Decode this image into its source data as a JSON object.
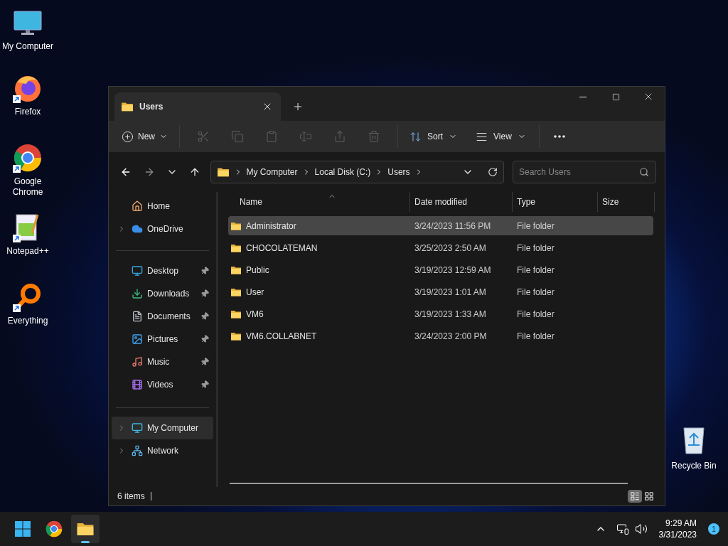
{
  "desktop_icons": [
    {
      "label": "My Computer",
      "kind": "monitor",
      "shortcut": false
    },
    {
      "label": "Firefox",
      "kind": "firefox",
      "shortcut": true
    },
    {
      "label": "Google Chrome",
      "kind": "chrome",
      "shortcut": true
    },
    {
      "label": "Notepad++",
      "kind": "notepad",
      "shortcut": true
    },
    {
      "label": "Everything",
      "kind": "everything",
      "shortcut": true
    }
  ],
  "recycle_bin": {
    "label": "Recycle Bin"
  },
  "window": {
    "tab": {
      "title": "Users"
    },
    "toolbar": {
      "new": "New",
      "actions": [
        {
          "kind": "cut",
          "disabled": true
        },
        {
          "kind": "copy",
          "disabled": true
        },
        {
          "kind": "paste",
          "disabled": true
        },
        {
          "kind": "rename",
          "disabled": true
        },
        {
          "kind": "share",
          "disabled": true
        },
        {
          "kind": "delete",
          "disabled": true
        }
      ],
      "sort": "Sort",
      "view": "View"
    },
    "nav": {
      "back_disabled": false,
      "forward_disabled": true
    },
    "breadcrumb": [
      "My Computer",
      "Local Disk (C:)",
      "Users"
    ],
    "search": {
      "placeholder": "Search Users"
    },
    "sidebar": [
      {
        "group": [
          {
            "label": "Home",
            "kind": "home",
            "expandable": false,
            "pinned": false,
            "selected": false
          },
          {
            "label": "OneDrive",
            "kind": "cloud",
            "expandable": true,
            "pinned": false,
            "selected": false
          }
        ]
      },
      {
        "group": [
          {
            "label": "Desktop",
            "kind": "desktop",
            "expandable": false,
            "pinned": true,
            "selected": false
          },
          {
            "label": "Downloads",
            "kind": "download",
            "expandable": false,
            "pinned": true,
            "selected": false
          },
          {
            "label": "Documents",
            "kind": "document",
            "expandable": false,
            "pinned": true,
            "selected": false
          },
          {
            "label": "Pictures",
            "kind": "picture",
            "expandable": false,
            "pinned": true,
            "selected": false
          },
          {
            "label": "Music",
            "kind": "music",
            "expandable": false,
            "pinned": true,
            "selected": false
          },
          {
            "label": "Videos",
            "kind": "video",
            "expandable": false,
            "pinned": true,
            "selected": false
          }
        ]
      },
      {
        "group": [
          {
            "label": "My Computer",
            "kind": "monitor",
            "expandable": true,
            "pinned": false,
            "selected": true
          },
          {
            "label": "Network",
            "kind": "network",
            "expandable": true,
            "pinned": false,
            "selected": false
          }
        ]
      }
    ],
    "columns": [
      "Name",
      "Date modified",
      "Type",
      "Size"
    ],
    "rows": [
      {
        "name": "Administrator",
        "date": "3/24/2023 11:56 PM",
        "type": "File folder",
        "selected": true
      },
      {
        "name": "CHOCOLATEMAN",
        "date": "3/25/2023 2:50 AM",
        "type": "File folder",
        "selected": false
      },
      {
        "name": "Public",
        "date": "3/19/2023 12:59 AM",
        "type": "File folder",
        "selected": false
      },
      {
        "name": "User",
        "date": "3/19/2023 1:01 AM",
        "type": "File folder",
        "selected": false
      },
      {
        "name": "VM6",
        "date": "3/19/2023 1:33 AM",
        "type": "File folder",
        "selected": false
      },
      {
        "name": "VM6.COLLABNET",
        "date": "3/24/2023 2:00 PM",
        "type": "File folder",
        "selected": false
      }
    ],
    "status": "6 items",
    "views": [
      {
        "kind": "details",
        "selected": true
      },
      {
        "kind": "tiles",
        "selected": false
      }
    ]
  },
  "taskbar": {
    "apps": [
      {
        "kind": "start",
        "active": false
      },
      {
        "kind": "chrome",
        "active": false
      },
      {
        "kind": "explorer",
        "active": true
      }
    ],
    "time": "9:29 AM",
    "date": "3/31/2023",
    "notifications": "1"
  }
}
